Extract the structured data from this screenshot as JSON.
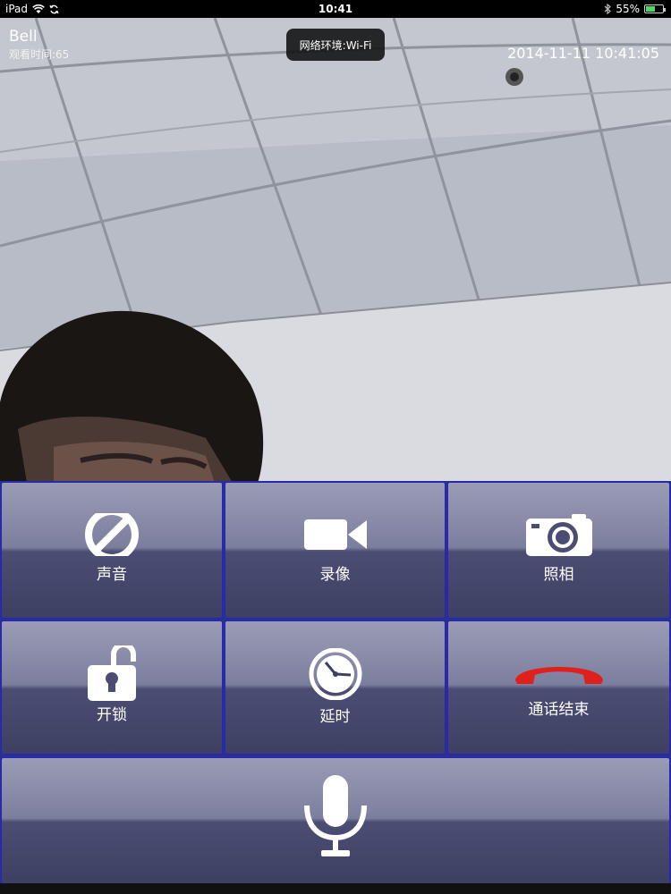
{
  "status_bar": {
    "device": "iPad",
    "time": "10:41",
    "battery": "55%",
    "battery_level": 0.55
  },
  "call": {
    "name": "Bell",
    "watch_time": "观看时间:65",
    "datetime": "2014-11-11 10:41:05",
    "network_toast": "网络环境:Wi-Fi"
  },
  "controls": {
    "sound": {
      "label": "声音",
      "icon": "mute-icon"
    },
    "record": {
      "label": "录像",
      "icon": "video-camera-icon"
    },
    "photo": {
      "label": "照相",
      "icon": "camera-icon"
    },
    "unlock": {
      "label": "开锁",
      "icon": "unlock-icon"
    },
    "delay": {
      "label": "延时",
      "icon": "clock-icon"
    },
    "hangup": {
      "label": "通话结束",
      "icon": "hangup-phone-icon"
    },
    "talk": {
      "icon": "microphone-icon"
    }
  },
  "colors": {
    "button_border": "#2424c4",
    "hangup_red": "#e0201c"
  }
}
